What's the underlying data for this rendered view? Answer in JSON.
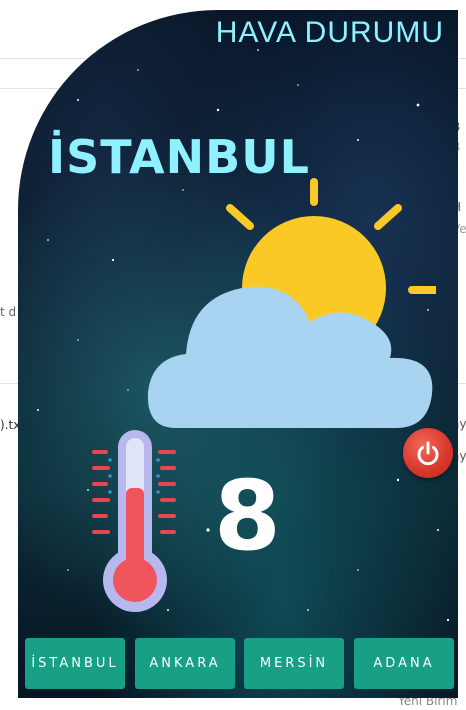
{
  "widget": {
    "title": "HAVA DURUMU",
    "city": "İSTANBUL",
    "temperature": "8",
    "weather_icon": "partly-cloudy-icon",
    "thermometer_icon": "thermometer-icon",
    "power_icon": "power-icon",
    "buttons": [
      {
        "label": "İSTANBUL"
      },
      {
        "label": "ANKARA"
      },
      {
        "label": "MERSİN"
      },
      {
        "label": "ADANA"
      }
    ],
    "colors": {
      "title": "#8ff0ff",
      "button": "#17a085",
      "sun": "#fbc926",
      "cloud": "#a8d4f2",
      "power": "#d8352a"
    }
  },
  "background_page": {
    "fragment_left_1": "t d",
    "fragment_left_2": ").tx",
    "fragment_bottom_right": "Yeni Birim",
    "fragment_right_a": "B",
    "fragment_right_b": "B",
    "fragment_right_c": "H",
    "fragment_right_d": "Ve",
    "fragment_right_e": "ay",
    "fragment_right_f": "ay"
  }
}
